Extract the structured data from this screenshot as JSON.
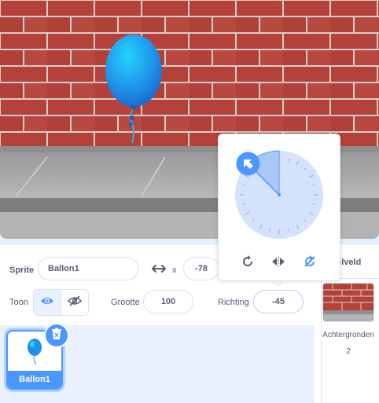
{
  "stage": {
    "sprite_name": "Ballon1",
    "backdrop": "brick-wall"
  },
  "sprite_info": {
    "sprite_label": "Sprite",
    "sprite_name_value": "Ballon1",
    "x_label": "x",
    "x_value": "-78",
    "show_label": "Toon",
    "size_label": "Grootte",
    "size_value": "100",
    "direction_label": "Richting",
    "direction_value": "-45"
  },
  "direction_popover": {
    "angle_degrees": -45,
    "modes": [
      "rotate-all-around",
      "left-right",
      "dont-rotate"
    ],
    "active_mode": "dont-rotate"
  },
  "sprite_list": {
    "items": [
      {
        "name": "Ballon1",
        "selected": true
      }
    ]
  },
  "stage_pane": {
    "header": "Speelveld",
    "header_visible": "eelveld",
    "backdrops_label": "Achtergronden",
    "backdrops_count": "2"
  },
  "colors": {
    "accent": "#4c97ff",
    "text": "#575e75",
    "brick": "#b5423a",
    "mortar": "#d3d3d3",
    "balloon": "#1f8fe8",
    "pavement": "#a8a8a8"
  }
}
